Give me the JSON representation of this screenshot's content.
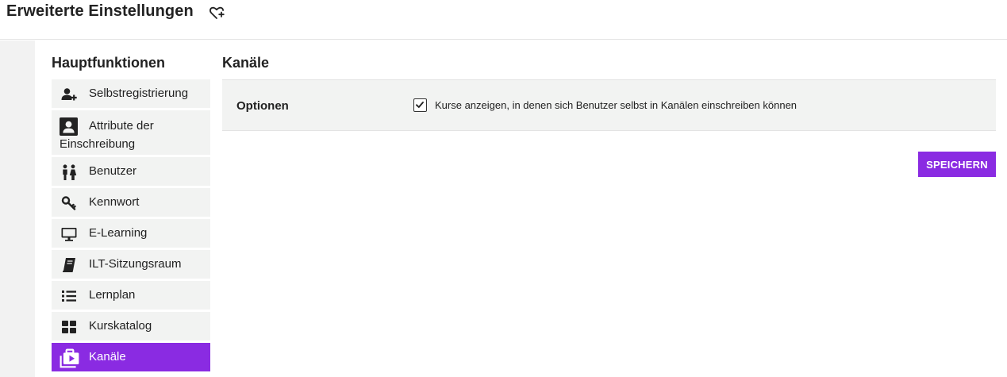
{
  "header": {
    "title": "Erweiterte Einstellungen",
    "favorite_icon": "heart-plus-icon"
  },
  "sidebar": {
    "title": "Hauptfunktionen",
    "items": [
      {
        "label": "Selbstregistrierung",
        "icon": "user-plus-icon"
      },
      {
        "label": "Attribute der Einschreibung",
        "icon": "contact-card-icon"
      },
      {
        "label": "Benutzer",
        "icon": "people-icon"
      },
      {
        "label": "Kennwort",
        "icon": "key-icon"
      },
      {
        "label": "E-Learning",
        "icon": "monitor-icon"
      },
      {
        "label": "ILT-Sitzungsraum",
        "icon": "book-icon"
      },
      {
        "label": "Lernplan",
        "icon": "list-icon"
      },
      {
        "label": "Kurskatalog",
        "icon": "grid-icon"
      },
      {
        "label": "Kanäle",
        "icon": "channel-play-icon",
        "active": true
      }
    ]
  },
  "main": {
    "title": "Kanäle",
    "options": {
      "label": "Optionen",
      "checkbox_label": "Kurse anzeigen, in denen sich Benutzer selbst in Kanälen einschreiben können",
      "checked": true
    },
    "save_label": "SPEICHERN"
  },
  "colors": {
    "accent": "#8a2be2",
    "panel": "#f2f3f2",
    "rail": "#f2f2f2"
  }
}
